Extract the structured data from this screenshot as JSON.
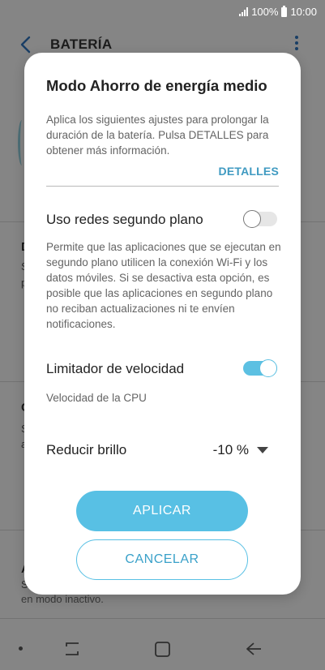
{
  "status_bar": {
    "battery_percent": "100%",
    "time": "10:00"
  },
  "app_bar": {
    "title": "BATERÍA"
  },
  "background": {
    "frag_1": "D",
    "frag_2": "S",
    "frag_3": "p",
    "frag_4": "C",
    "frag_5": "S",
    "frag_6": "a",
    "frag_7": "A",
    "frag_8": "S",
    "bottom_text": "en modo inactivo."
  },
  "dialog": {
    "title": "Modo Ahorro de energía medio",
    "description": "Aplica los siguientes ajustes para prolongar la duración de la batería. Pulsa DETALLES para obtener más información.",
    "details_link": "DETALLES",
    "background_data": {
      "label": "Uso redes segundo plano",
      "description": "Permite que las aplicaciones que se ejecutan en segundo plano utilicen la conexión Wi-Fi y los datos móviles. Si se desactiva esta opción, es posible que las aplicaciones en segundo plano no reciban actualizaciones ni te envíen notificaciones.",
      "enabled": false
    },
    "speed_limiter": {
      "label": "Limitador de velocidad",
      "description": "Velocidad de la CPU",
      "enabled": true
    },
    "brightness": {
      "label": "Reducir brillo",
      "value": "-10 %"
    },
    "apply_button": "APLICAR",
    "cancel_button": "CANCELAR"
  },
  "colors": {
    "accent": "#58c0e4",
    "link": "#3f9ac1"
  }
}
